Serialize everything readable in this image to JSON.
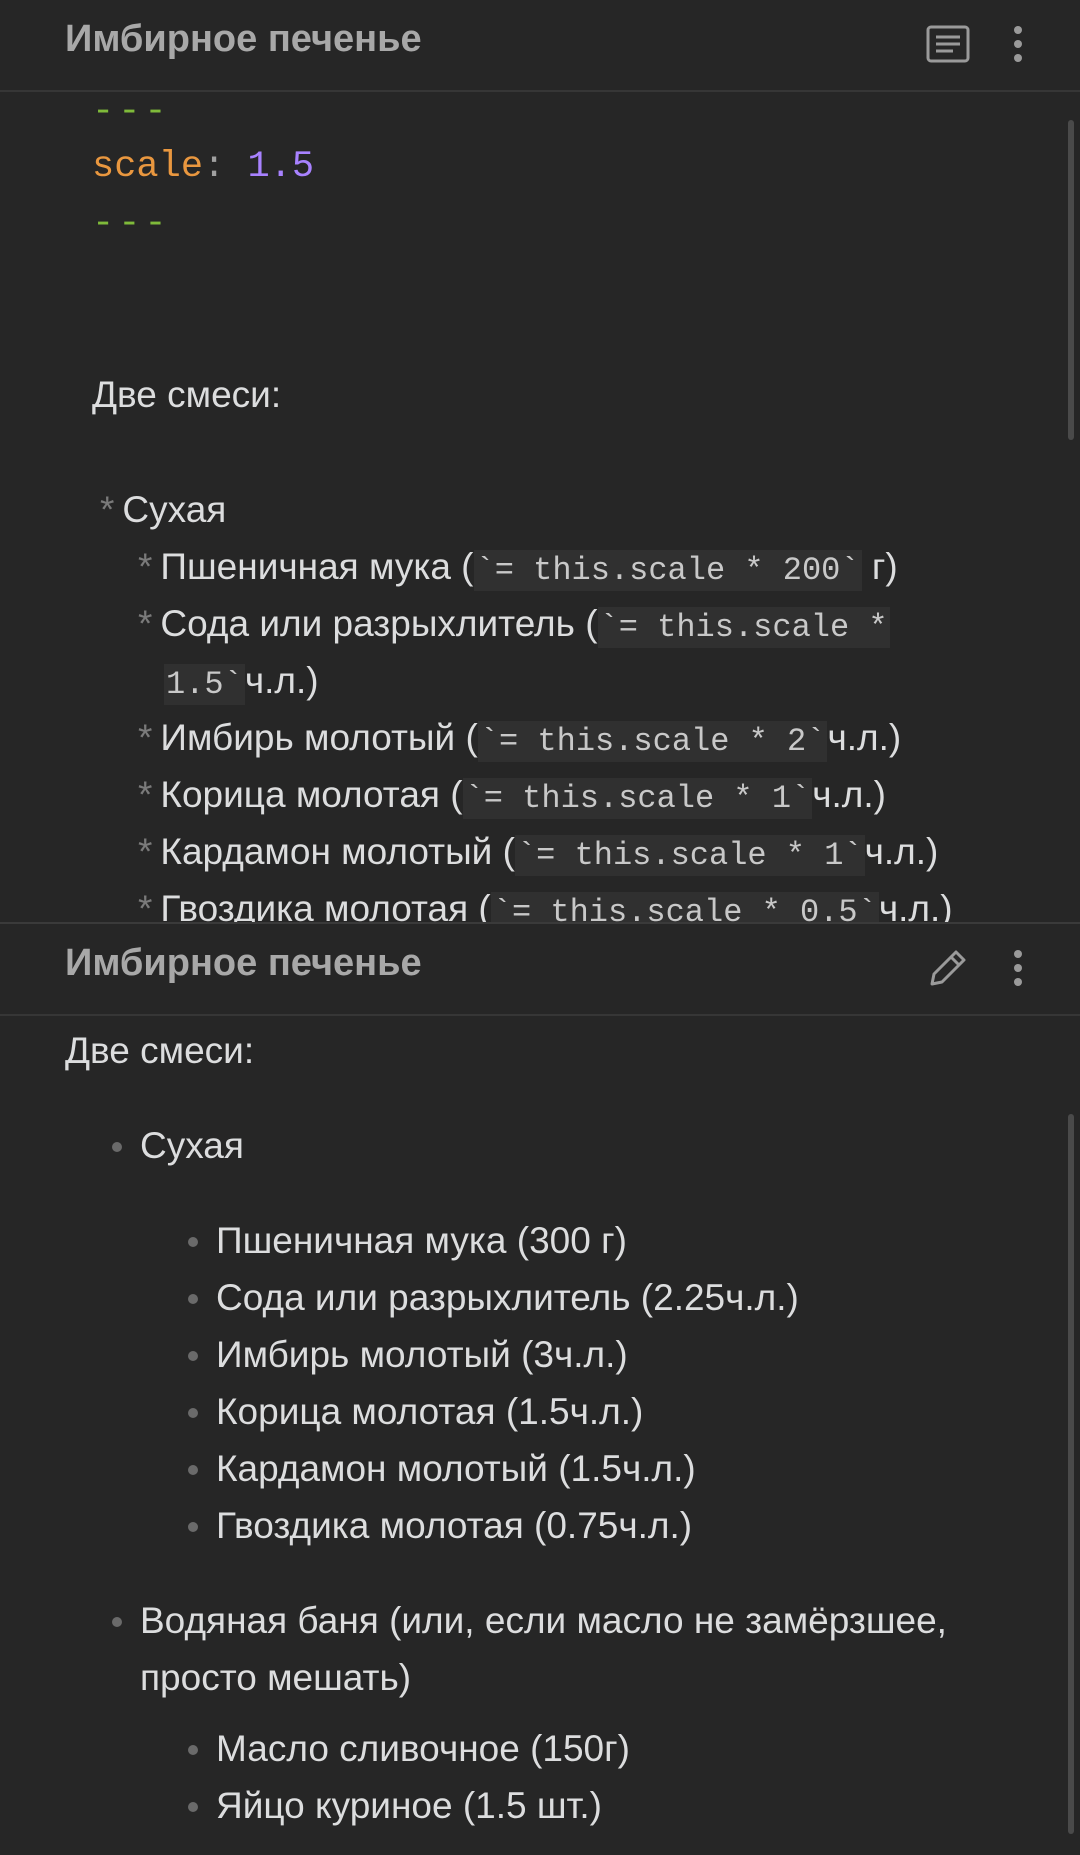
{
  "editor": {
    "title": "Имбирное печенье",
    "frontmatter": {
      "dashes_open": "---",
      "key": "scale",
      "colon": ":",
      "value": "1.5",
      "dashes_close": "---"
    },
    "intro": "Две смеси:",
    "list": [
      {
        "star": "*",
        "text": "Сухая"
      },
      {
        "star": "*",
        "pre": "Пшеничная мука (",
        "code": "`= this.scale * 200`",
        "post": " г)"
      },
      {
        "star": "*",
        "pre": "Сода или разрыхлитель (",
        "code": "`= this.scale *",
        "post": ""
      },
      {
        "code": "1.5`",
        "post": "ч.л.)"
      },
      {
        "star": "*",
        "pre": "Имбирь молотый (",
        "code": "`= this.scale * 2`",
        "post": "ч.л.)"
      },
      {
        "star": "*",
        "pre": "Корица молотая (",
        "code": "`= this.scale * 1`",
        "post": "ч.л.)"
      },
      {
        "star": "*",
        "pre": "Кардамон молотый (",
        "code": "`= this.scale * 1`",
        "post": "ч.л.)"
      },
      {
        "star": "*",
        "pre": "Гвоздика молотая (",
        "code": "`= this.scale * 0.5`",
        "post": "ч.л.)"
      }
    ]
  },
  "preview": {
    "title": "Имбирное печенье",
    "intro": "Две смеси:",
    "groups": [
      {
        "label": "Сухая"
      },
      {
        "items": [
          "Пшеничная мука (300 г)",
          "Сода или разрыхлитель (2.25ч.л.)",
          "Имбирь молотый (3ч.л.)",
          "Корица молотая (1.5ч.л.)",
          "Кардамон молотый (1.5ч.л.)",
          "Гвоздика молотая (0.75ч.л.)"
        ]
      },
      {
        "label_line1": "Водяная баня (или, если масло не замёрзшее,",
        "label_line2": "просто мешать)"
      },
      {
        "items": [
          "Масло сливочное (150г)",
          "Яйцо куриное (1.5 шт.)"
        ]
      }
    ]
  },
  "icons": {
    "reading_mode": "book-icon",
    "edit_mode": "pencil-icon",
    "more": "more-vertical-icon"
  }
}
